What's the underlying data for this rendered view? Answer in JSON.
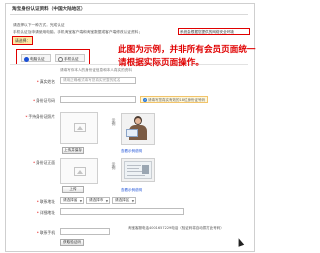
{
  "page": {
    "title": "淘宝身份认证资料（中国大陆地区）"
  },
  "intro": {
    "line1": "请选择以下一种方式，完成认证",
    "line2": "手机认证及申请使用电脑，手机淘宝客户端和淘宝数据或客户端修改认证资料；",
    "notice": "系统会根据您提供的网络安全环境",
    "method_label": "请选择：",
    "method_highlight_color": "#e00000"
  },
  "tabs": [
    {
      "label": "电脑认证",
      "selected": true
    },
    {
      "label": "手机认证",
      "selected": false
    }
  ],
  "callout": {
    "line1": "此图为示例，并非所有会员页面统一",
    "line2": "请根据实际页面操作。",
    "color": "#e00000"
  },
  "form": {
    "hint": "请填写你本人的身份证信息和本人真实的资料",
    "name": {
      "label": "真实姓名",
      "placeholder": "请用正确格式填写您真实完整的姓名"
    },
    "id_number": {
      "label": "身份证号码",
      "tip": "请填写您真实有效的18位身份证号码"
    },
    "hold_photo": {
      "label": "手持身份证照片",
      "upload_button": "上传并保存",
      "example_label": "示例",
      "view_link": "查看示例说明"
    },
    "front_photo": {
      "label": "身份证正面",
      "upload_button": "上传",
      "example_label": "示例",
      "view_link": "查看示例说明"
    },
    "address": {
      "label": "联系地址",
      "province": "请选择省",
      "city": "请选择市",
      "district": "请选择区"
    },
    "detail_address": {
      "label": "详细地址"
    },
    "phone": {
      "label": "联系手机",
      "button": "获取验证码",
      "note": "淘宝客服电话4001657229电话（验证码将自动拨打此号码）"
    }
  }
}
